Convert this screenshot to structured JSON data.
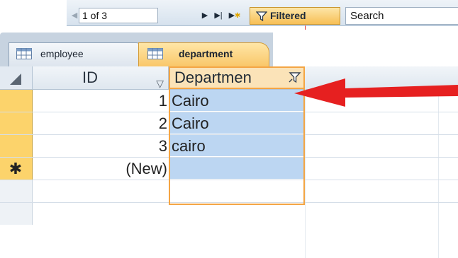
{
  "nav": {
    "record": "1 of 3",
    "filter_label": "Filtered",
    "search_label": "Search",
    "buttons": [
      "first-record",
      "next-record",
      "last-record",
      "new-record"
    ]
  },
  "tabs": [
    {
      "label": "employee",
      "active": false
    },
    {
      "label": "department",
      "active": true
    }
  ],
  "grid": {
    "columns": [
      {
        "label": "ID"
      },
      {
        "label": "Departmen"
      }
    ],
    "rows": [
      {
        "id": "1",
        "department": "Cairo"
      },
      {
        "id": "2",
        "department": "Cairo"
      },
      {
        "id": "3",
        "department": "cairo"
      }
    ],
    "new_row": {
      "marker": "✱",
      "id": "(New)",
      "department": ""
    }
  },
  "colors": {
    "active_tab": "#f9c76a",
    "selected_column": "#bcd6f2",
    "column_outline": "#f4a544",
    "row_selector": "#fcd36b",
    "annotation_arrow": "#e62020"
  }
}
